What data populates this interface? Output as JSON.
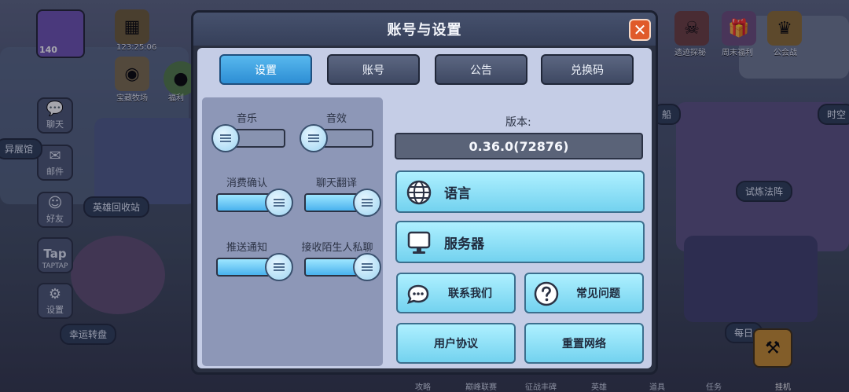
{
  "dialog": {
    "title": "账号与设置",
    "close_label": "✕",
    "tabs": [
      {
        "label": "设置",
        "active": true
      },
      {
        "label": "账号",
        "active": false
      },
      {
        "label": "公告",
        "active": false
      },
      {
        "label": "兑换码",
        "active": false
      }
    ]
  },
  "settings": {
    "music": {
      "label": "音乐",
      "on": false
    },
    "sfx": {
      "label": "音效",
      "on": false
    },
    "purchase_confirm": {
      "label": "消费确认",
      "on": true
    },
    "chat_translate": {
      "label": "聊天翻译",
      "on": true
    },
    "push_notify": {
      "label": "推送通知",
      "on": true
    },
    "stranger_chat": {
      "label": "接收陌生人私聊",
      "on": true
    }
  },
  "version": {
    "label": "版本:",
    "value": "0.36.0(72876)"
  },
  "buttons": {
    "language": "语言",
    "server": "服务器",
    "contact": "联系我们",
    "faq": "常见问题",
    "agreement": "用户协议",
    "reset_network": "重置网络"
  },
  "background": {
    "player_level": "140",
    "timer": "123:25:06",
    "top_labels": [
      "遗迹探秘",
      "周末福利",
      "公会战"
    ],
    "treasure_label": "宝藏牧场",
    "welfare_label": "福利",
    "side": [
      "聊天",
      "邮件",
      "好友",
      "TAPTAP",
      "设置"
    ],
    "tap_label": "Tap",
    "map": {
      "exhibit": "异展馆",
      "recycle": "英雄回收站",
      "wheel": "幸运转盘",
      "trial": "试炼法阵",
      "ship": "船",
      "timespace": "时空",
      "daily": "每日"
    },
    "bottom": [
      "攻略",
      "巅峰联赛",
      "征战丰碑",
      "英雄",
      "道具",
      "任务",
      "挂机"
    ]
  },
  "colors": {
    "tab_active": "#3a9fe0",
    "button_face": "#8fdcf2",
    "close": "#e05a2a"
  }
}
